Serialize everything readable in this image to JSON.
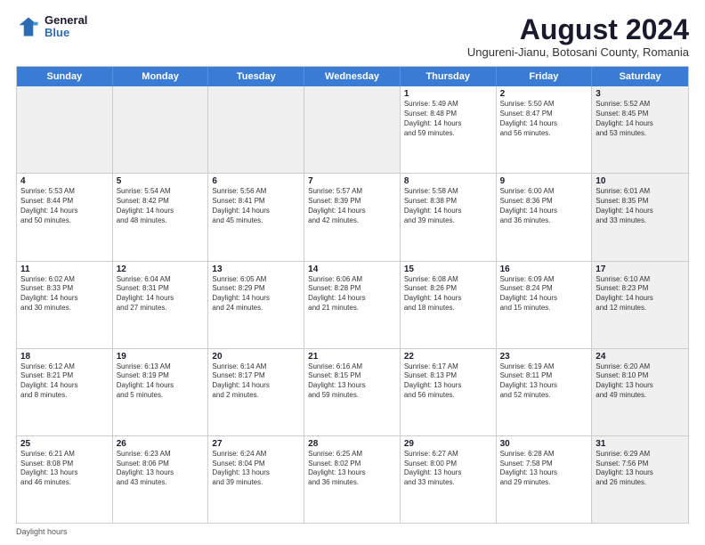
{
  "logo": {
    "line1": "General",
    "line2": "Blue"
  },
  "title": "August 2024",
  "location": "Ungureni-Jianu, Botosani County, Romania",
  "days_of_week": [
    "Sunday",
    "Monday",
    "Tuesday",
    "Wednesday",
    "Thursday",
    "Friday",
    "Saturday"
  ],
  "footer": "Daylight hours",
  "weeks": [
    [
      {
        "day": "",
        "text": "",
        "shaded": true
      },
      {
        "day": "",
        "text": "",
        "shaded": true
      },
      {
        "day": "",
        "text": "",
        "shaded": true
      },
      {
        "day": "",
        "text": "",
        "shaded": true
      },
      {
        "day": "1",
        "text": "Sunrise: 5:49 AM\nSunset: 8:48 PM\nDaylight: 14 hours\nand 59 minutes.",
        "shaded": false
      },
      {
        "day": "2",
        "text": "Sunrise: 5:50 AM\nSunset: 8:47 PM\nDaylight: 14 hours\nand 56 minutes.",
        "shaded": false
      },
      {
        "day": "3",
        "text": "Sunrise: 5:52 AM\nSunset: 8:45 PM\nDaylight: 14 hours\nand 53 minutes.",
        "shaded": true
      }
    ],
    [
      {
        "day": "4",
        "text": "Sunrise: 5:53 AM\nSunset: 8:44 PM\nDaylight: 14 hours\nand 50 minutes.",
        "shaded": false
      },
      {
        "day": "5",
        "text": "Sunrise: 5:54 AM\nSunset: 8:42 PM\nDaylight: 14 hours\nand 48 minutes.",
        "shaded": false
      },
      {
        "day": "6",
        "text": "Sunrise: 5:56 AM\nSunset: 8:41 PM\nDaylight: 14 hours\nand 45 minutes.",
        "shaded": false
      },
      {
        "day": "7",
        "text": "Sunrise: 5:57 AM\nSunset: 8:39 PM\nDaylight: 14 hours\nand 42 minutes.",
        "shaded": false
      },
      {
        "day": "8",
        "text": "Sunrise: 5:58 AM\nSunset: 8:38 PM\nDaylight: 14 hours\nand 39 minutes.",
        "shaded": false
      },
      {
        "day": "9",
        "text": "Sunrise: 6:00 AM\nSunset: 8:36 PM\nDaylight: 14 hours\nand 36 minutes.",
        "shaded": false
      },
      {
        "day": "10",
        "text": "Sunrise: 6:01 AM\nSunset: 8:35 PM\nDaylight: 14 hours\nand 33 minutes.",
        "shaded": true
      }
    ],
    [
      {
        "day": "11",
        "text": "Sunrise: 6:02 AM\nSunset: 8:33 PM\nDaylight: 14 hours\nand 30 minutes.",
        "shaded": false
      },
      {
        "day": "12",
        "text": "Sunrise: 6:04 AM\nSunset: 8:31 PM\nDaylight: 14 hours\nand 27 minutes.",
        "shaded": false
      },
      {
        "day": "13",
        "text": "Sunrise: 6:05 AM\nSunset: 8:29 PM\nDaylight: 14 hours\nand 24 minutes.",
        "shaded": false
      },
      {
        "day": "14",
        "text": "Sunrise: 6:06 AM\nSunset: 8:28 PM\nDaylight: 14 hours\nand 21 minutes.",
        "shaded": false
      },
      {
        "day": "15",
        "text": "Sunrise: 6:08 AM\nSunset: 8:26 PM\nDaylight: 14 hours\nand 18 minutes.",
        "shaded": false
      },
      {
        "day": "16",
        "text": "Sunrise: 6:09 AM\nSunset: 8:24 PM\nDaylight: 14 hours\nand 15 minutes.",
        "shaded": false
      },
      {
        "day": "17",
        "text": "Sunrise: 6:10 AM\nSunset: 8:23 PM\nDaylight: 14 hours\nand 12 minutes.",
        "shaded": true
      }
    ],
    [
      {
        "day": "18",
        "text": "Sunrise: 6:12 AM\nSunset: 8:21 PM\nDaylight: 14 hours\nand 8 minutes.",
        "shaded": false
      },
      {
        "day": "19",
        "text": "Sunrise: 6:13 AM\nSunset: 8:19 PM\nDaylight: 14 hours\nand 5 minutes.",
        "shaded": false
      },
      {
        "day": "20",
        "text": "Sunrise: 6:14 AM\nSunset: 8:17 PM\nDaylight: 14 hours\nand 2 minutes.",
        "shaded": false
      },
      {
        "day": "21",
        "text": "Sunrise: 6:16 AM\nSunset: 8:15 PM\nDaylight: 13 hours\nand 59 minutes.",
        "shaded": false
      },
      {
        "day": "22",
        "text": "Sunrise: 6:17 AM\nSunset: 8:13 PM\nDaylight: 13 hours\nand 56 minutes.",
        "shaded": false
      },
      {
        "day": "23",
        "text": "Sunrise: 6:19 AM\nSunset: 8:11 PM\nDaylight: 13 hours\nand 52 minutes.",
        "shaded": false
      },
      {
        "day": "24",
        "text": "Sunrise: 6:20 AM\nSunset: 8:10 PM\nDaylight: 13 hours\nand 49 minutes.",
        "shaded": true
      }
    ],
    [
      {
        "day": "25",
        "text": "Sunrise: 6:21 AM\nSunset: 8:08 PM\nDaylight: 13 hours\nand 46 minutes.",
        "shaded": false
      },
      {
        "day": "26",
        "text": "Sunrise: 6:23 AM\nSunset: 8:06 PM\nDaylight: 13 hours\nand 43 minutes.",
        "shaded": false
      },
      {
        "day": "27",
        "text": "Sunrise: 6:24 AM\nSunset: 8:04 PM\nDaylight: 13 hours\nand 39 minutes.",
        "shaded": false
      },
      {
        "day": "28",
        "text": "Sunrise: 6:25 AM\nSunset: 8:02 PM\nDaylight: 13 hours\nand 36 minutes.",
        "shaded": false
      },
      {
        "day": "29",
        "text": "Sunrise: 6:27 AM\nSunset: 8:00 PM\nDaylight: 13 hours\nand 33 minutes.",
        "shaded": false
      },
      {
        "day": "30",
        "text": "Sunrise: 6:28 AM\nSunset: 7:58 PM\nDaylight: 13 hours\nand 29 minutes.",
        "shaded": false
      },
      {
        "day": "31",
        "text": "Sunrise: 6:29 AM\nSunset: 7:56 PM\nDaylight: 13 hours\nand 26 minutes.",
        "shaded": true
      }
    ]
  ]
}
